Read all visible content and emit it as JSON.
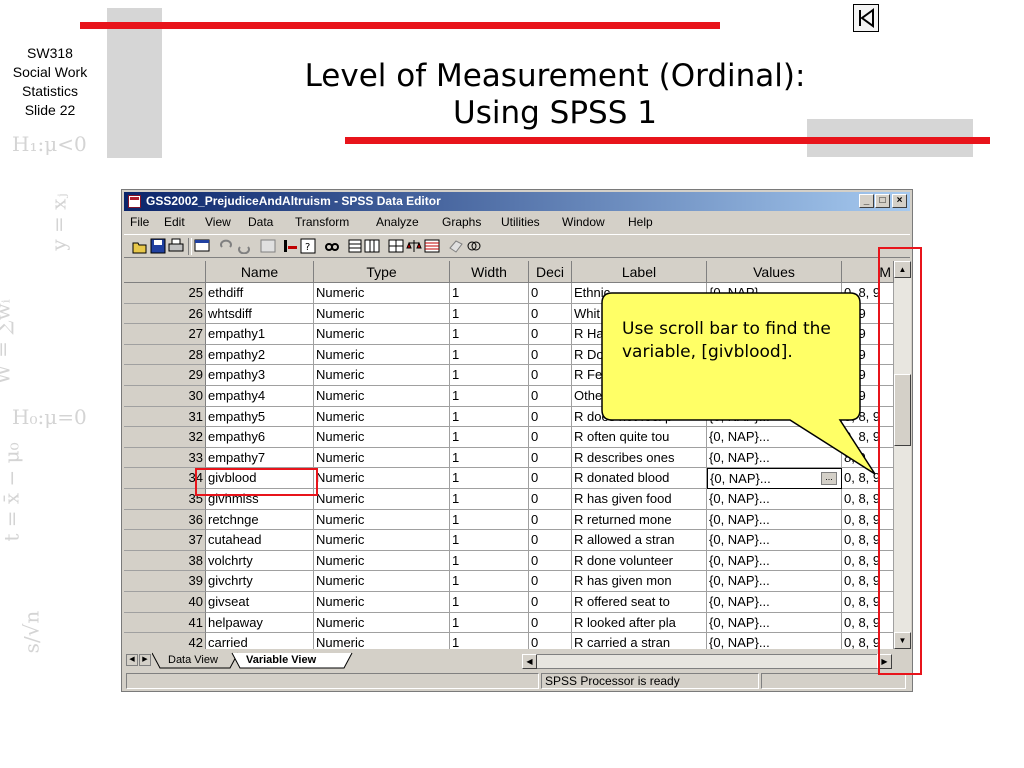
{
  "slide": {
    "course_lines": [
      "SW318",
      "Social Work",
      "Statistics",
      "Slide 22"
    ],
    "title_lines": [
      "Level of Measurement (Ordinal):",
      "Using SPSS 1"
    ],
    "callout_text": "Use scroll bar to find the variable, [givblood].",
    "accent_color": "#e8141b",
    "decor_formulas": [
      "H₁:μ<0",
      "H₀:μ=0",
      "W = ∑wᵢ",
      "t = x̄ − μ₀",
      "y = xⱼ",
      "s/√n"
    ]
  },
  "window": {
    "title": "GSS2002_PrejudiceAndAltruism - SPSS Data Editor",
    "controls": [
      "_",
      "□",
      "×"
    ],
    "menu": [
      "File",
      "Edit",
      "View",
      "Data",
      "Transform",
      "Analyze",
      "Graphs",
      "Utilities",
      "Window",
      "Help"
    ],
    "toolbar_icons": [
      "open-icon",
      "save-icon",
      "print-icon",
      "dialog-recall-icon",
      "undo-icon",
      "redo-icon",
      "goto-chart-icon",
      "goto-case-icon",
      "variables-icon",
      "find-icon",
      "insert-case-icon",
      "insert-variable-icon",
      "split-file-icon",
      "weight-cases-icon",
      "select-cases-icon",
      "value-labels-icon",
      "use-sets-icon"
    ]
  },
  "grid": {
    "headers": [
      "Name",
      "Type",
      "Width",
      "Deci",
      "Label",
      "Values",
      "M"
    ],
    "rows": [
      {
        "num": "25",
        "name": "ethdiff",
        "type": "Numeric",
        "width": "1",
        "deci": "0",
        "label": "Ethnic",
        "values": "{0, NAP}...",
        "missing": "0, 8, 9"
      },
      {
        "num": "26",
        "name": "whtsdiff",
        "type": "Numeric",
        "width": "1",
        "deci": "0",
        "label": "Whit",
        "values": "",
        "missing": "8, 9"
      },
      {
        "num": "27",
        "name": "empathy1",
        "type": "Numeric",
        "width": "1",
        "deci": "0",
        "label": "R Ha",
        "values": "",
        "missing": "8, 9"
      },
      {
        "num": "28",
        "name": "empathy2",
        "type": "Numeric",
        "width": "1",
        "deci": "0",
        "label": "R Do",
        "values": "",
        "missing": "8, 9"
      },
      {
        "num": "29",
        "name": "empathy3",
        "type": "Numeric",
        "width": "1",
        "deci": "0",
        "label": "R Fe",
        "values": "",
        "missing": "8, 9"
      },
      {
        "num": "30",
        "name": "empathy4",
        "type": "Numeric",
        "width": "1",
        "deci": "0",
        "label": "Othe",
        "values": "",
        "missing": "8, 9"
      },
      {
        "num": "31",
        "name": "empathy5",
        "type": "Numeric",
        "width": "1",
        "deci": "0",
        "label": "R does not feel p",
        "values": "{0, NAP}...",
        "missing": "0, 8, 9"
      },
      {
        "num": "32",
        "name": "empathy6",
        "type": "Numeric",
        "width": "1",
        "deci": "0",
        "label": "R often quite tou",
        "values": "{0, NAP}...",
        "missing": "0, 8, 9"
      },
      {
        "num": "33",
        "name": "empathy7",
        "type": "Numeric",
        "width": "1",
        "deci": "0",
        "label": "R describes ones",
        "values": "{0, NAP}...",
        "missing": "8, 9"
      },
      {
        "num": "34",
        "name": "givblood",
        "type": "Numeric",
        "width": "1",
        "deci": "0",
        "label": "R donated blood",
        "values": "{0, NAP}...",
        "missing": "0, 8, 9"
      },
      {
        "num": "35",
        "name": "givhmiss",
        "type": "Numeric",
        "width": "1",
        "deci": "0",
        "label": "R has given food",
        "values": "{0, NAP}...",
        "missing": "0, 8, 9"
      },
      {
        "num": "36",
        "name": "retchnge",
        "type": "Numeric",
        "width": "1",
        "deci": "0",
        "label": "R returned mone",
        "values": "{0, NAP}...",
        "missing": "0, 8, 9"
      },
      {
        "num": "37",
        "name": "cutahead",
        "type": "Numeric",
        "width": "1",
        "deci": "0",
        "label": "R allowed a stran",
        "values": "{0, NAP}...",
        "missing": "0, 8, 9"
      },
      {
        "num": "38",
        "name": "volchrty",
        "type": "Numeric",
        "width": "1",
        "deci": "0",
        "label": "R done volunteer",
        "values": "{0, NAP}...",
        "missing": "0, 8, 9"
      },
      {
        "num": "39",
        "name": "givchrty",
        "type": "Numeric",
        "width": "1",
        "deci": "0",
        "label": "R has given mon",
        "values": "{0, NAP}...",
        "missing": "0, 8, 9"
      },
      {
        "num": "40",
        "name": "givseat",
        "type": "Numeric",
        "width": "1",
        "deci": "0",
        "label": "R offered seat to",
        "values": "{0, NAP}...",
        "missing": "0, 8, 9"
      },
      {
        "num": "41",
        "name": "helpaway",
        "type": "Numeric",
        "width": "1",
        "deci": "0",
        "label": "R looked after pla",
        "values": "{0, NAP}...",
        "missing": "0, 8, 9"
      },
      {
        "num": "42",
        "name": "carried",
        "type": "Numeric",
        "width": "1",
        "deci": "0",
        "label": "R carried a stran",
        "values": "{0, NAP}...",
        "missing": "0, 8, 9"
      }
    ],
    "selected_row": "34"
  },
  "tabs": {
    "data_view": "Data View",
    "variable_view": "Variable View",
    "active": "Variable View"
  },
  "status": {
    "processor": "SPSS Processor  is ready"
  }
}
